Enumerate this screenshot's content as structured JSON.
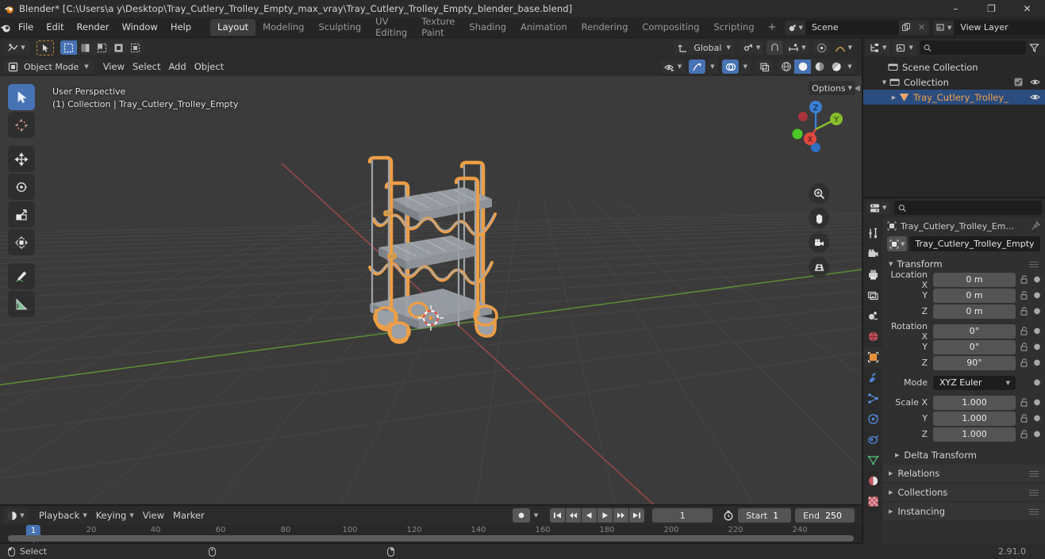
{
  "titlebar": {
    "title": "Blender* [C:\\Users\\a y\\Desktop\\Tray_Cutlery_Trolley_Empty_max_vray\\Tray_Cutlery_Trolley_Empty_blender_base.blend]",
    "minimize": "–",
    "maximize": "❐",
    "close": "✕"
  },
  "topbar": {
    "menus": [
      "File",
      "Edit",
      "Render",
      "Window",
      "Help"
    ],
    "workspaces": [
      {
        "label": "Layout",
        "active": true
      },
      {
        "label": "Modeling",
        "active": false
      },
      {
        "label": "Sculpting",
        "active": false
      },
      {
        "label": "UV Editing",
        "active": false
      },
      {
        "label": "Texture Paint",
        "active": false
      },
      {
        "label": "Shading",
        "active": false
      },
      {
        "label": "Animation",
        "active": false
      },
      {
        "label": "Rendering",
        "active": false
      },
      {
        "label": "Compositing",
        "active": false
      },
      {
        "label": "Scripting",
        "active": false
      }
    ],
    "add_workspace": "+",
    "scene_name": "Scene",
    "view_layer_name": "View Layer"
  },
  "viewport": {
    "mode": "Object Mode",
    "menus": [
      "View",
      "Select",
      "Add",
      "Object"
    ],
    "transform_orientation": "Global",
    "options_label": "Options",
    "overlay_text_line1": "User Perspective",
    "overlay_text_line2": "(1) Collection | Tray_Cutlery_Trolley_Empty",
    "gizmo_axes": {
      "z": "Z",
      "y": "Y",
      "x": "X"
    },
    "gizmo_colors": {
      "z": "#3b7fd4",
      "y": "#87bd2d",
      "x": "#e0483f"
    },
    "selection_color": "#ed9e45",
    "tools": [
      "tweak-select-tool",
      "cursor-tool",
      "move-tool",
      "rotate-tool",
      "scale-tool",
      "transform-tool",
      "annotate-tool",
      "measure-tool"
    ],
    "nav_buttons": [
      "zoom-icon",
      "pan-hand-icon",
      "camera-view-icon",
      "toggle-perspective-icon"
    ]
  },
  "outliner": {
    "search_placeholder": "",
    "rows": [
      {
        "label": "Scene Collection",
        "indent": 0,
        "icon": "collection-icon",
        "expand": "",
        "selected": false,
        "checkbox": false,
        "eye": false
      },
      {
        "label": "Collection",
        "indent": 1,
        "icon": "collection-icon",
        "expand": "▼",
        "selected": false,
        "checkbox": true,
        "eye": true
      },
      {
        "label": "Tray_Cutlery_Trolley_",
        "indent": 2,
        "icon": "mesh-object-icon",
        "expand": "▶",
        "selected": true,
        "checkbox": false,
        "eye": true
      }
    ]
  },
  "properties": {
    "search_placeholder": "",
    "breadcrumb": "Tray_Cutlery_Trolley_Em...",
    "object_name": "Tray_Cutlery_Trolley_Empty",
    "tabs": [
      {
        "name": "tool-properties-tab",
        "active": false
      },
      {
        "name": "render-properties-tab",
        "active": false
      },
      {
        "name": "output-properties-tab",
        "active": false
      },
      {
        "name": "view-layer-properties-tab",
        "active": false
      },
      {
        "name": "scene-properties-tab",
        "active": false
      },
      {
        "name": "world-properties-tab",
        "active": false
      },
      {
        "name": "object-properties-tab",
        "active": true
      },
      {
        "name": "modifier-properties-tab",
        "active": false
      },
      {
        "name": "particle-properties-tab",
        "active": false
      },
      {
        "name": "physics-properties-tab",
        "active": false
      },
      {
        "name": "constraint-properties-tab",
        "active": false
      },
      {
        "name": "data-properties-tab",
        "active": false
      },
      {
        "name": "material-properties-tab",
        "active": false
      },
      {
        "name": "texture-properties-tab",
        "active": false
      }
    ],
    "transform": {
      "title": "Transform",
      "location_label": "Location X",
      "rotation_label": "Rotation X",
      "scale_label": "Scale X",
      "y_label": "Y",
      "z_label": "Z",
      "mode_label": "Mode",
      "mode_value": "XYZ Euler",
      "location": {
        "x": "0 m",
        "y": "0 m",
        "z": "0 m"
      },
      "rotation": {
        "x": "0°",
        "y": "0°",
        "z": "90°"
      },
      "scale": {
        "x": "1.000",
        "y": "1.000",
        "z": "1.000"
      }
    },
    "panels": [
      {
        "label": "Delta Transform",
        "sub": true
      },
      {
        "label": "Relations",
        "sub": false
      },
      {
        "label": "Collections",
        "sub": false
      },
      {
        "label": "Instancing",
        "sub": false
      }
    ]
  },
  "timeline": {
    "menus": [
      "Playback",
      "Keying",
      "View",
      "Marker"
    ],
    "current_frame": "1",
    "start_label": "Start",
    "start_value": "1",
    "end_label": "End",
    "end_value": "250",
    "ruler_ticks": [
      "20",
      "40",
      "60",
      "80",
      "100",
      "120",
      "140",
      "160",
      "180",
      "200",
      "220",
      "240"
    ],
    "playhead_label": "1"
  },
  "statusbar": {
    "select_label": "Select",
    "version": "2.91.0"
  }
}
